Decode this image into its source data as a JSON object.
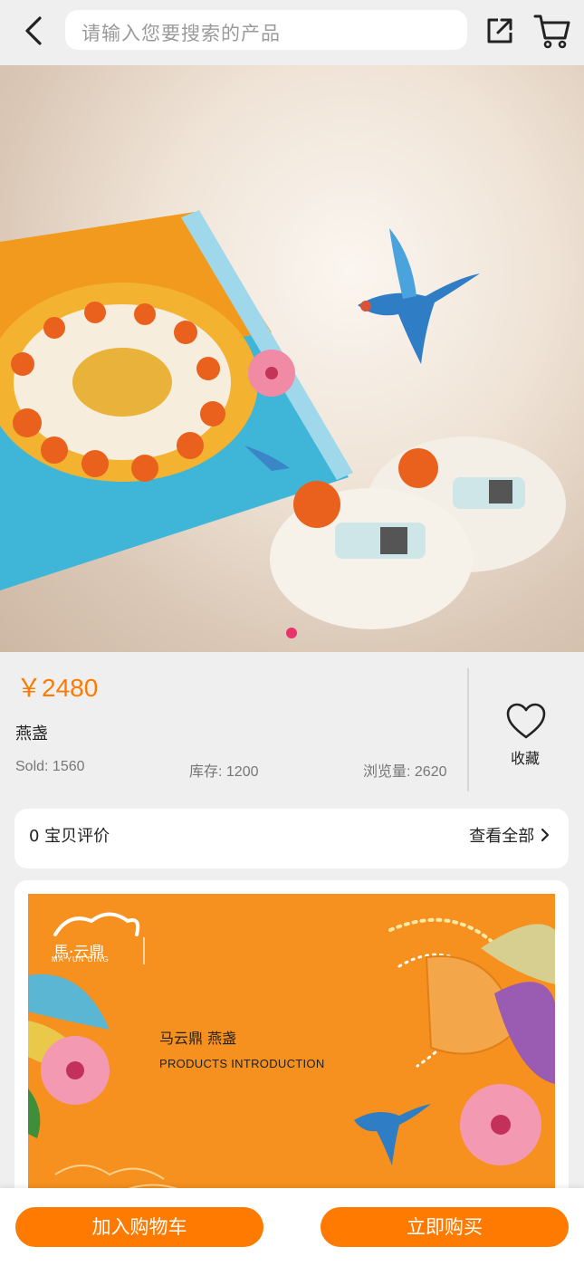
{
  "header": {
    "search_placeholder": "请输入您要搜索的产品",
    "icons": [
      "back-icon",
      "share-icon",
      "cart-icon"
    ]
  },
  "gallery": {
    "total_slides": 1,
    "active_slide": 1
  },
  "product": {
    "price": "￥2480",
    "name": "燕盏",
    "sold": "Sold: 1560",
    "stock": "库存: 1200",
    "views": "浏览量: 2620",
    "favorite_label": "收藏"
  },
  "reviews": {
    "count_label": "0 宝贝评价",
    "view_all": "查看全部"
  },
  "detail_banner": {
    "brand": "馬·云鼎",
    "brand_sub": "MA YUN DING",
    "title": "马云鼎 燕盏",
    "subtitle": "PRODUCTS INTRODUCTION"
  },
  "actions": {
    "add_to_cart": "加入购物车",
    "buy_now": "立即购买"
  },
  "colors": {
    "accent": "#ff7a00",
    "indicator": "#e8336d",
    "background": "#efefef"
  }
}
